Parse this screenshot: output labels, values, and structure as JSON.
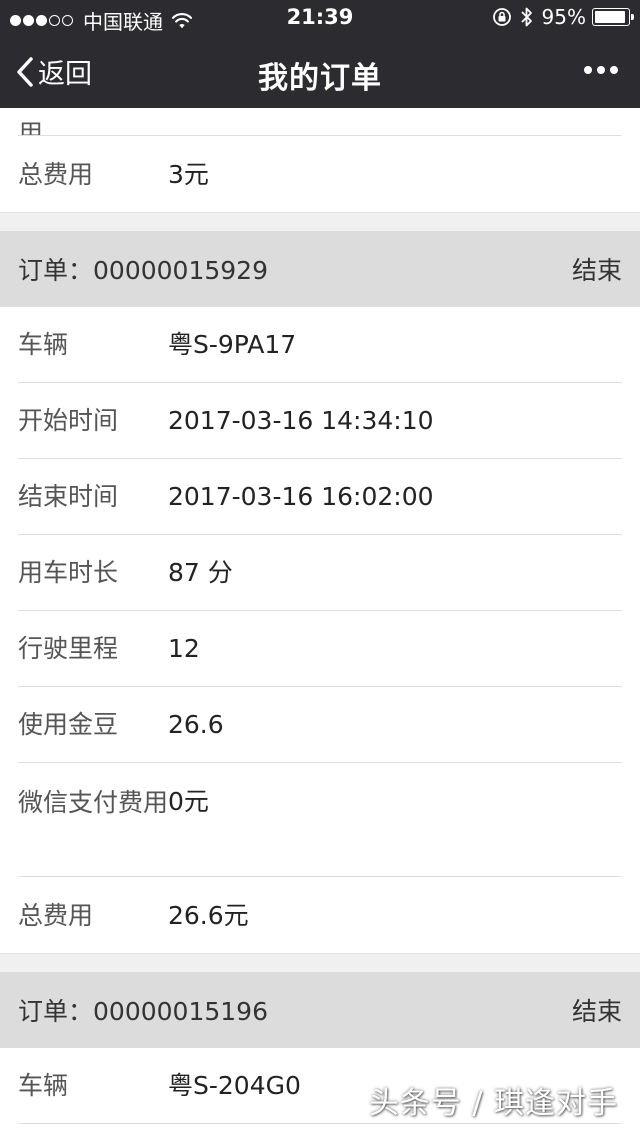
{
  "status_bar": {
    "carrier": "中国联通",
    "time": "21:39",
    "battery": "95%",
    "battery_level": 0.95
  },
  "nav": {
    "back_label": "返回",
    "title": "我的订单"
  },
  "previous_order_tail": {
    "partial_label": "用",
    "total_label": "总费用",
    "total_value": "3元"
  },
  "orders": [
    {
      "order_label": "订单：",
      "order_no": "00000015929",
      "status": "结束",
      "rows": [
        {
          "label": "车辆",
          "value": "粤S-9PA17"
        },
        {
          "label": "开始时间",
          "value": "2017-03-16 14:34:10"
        },
        {
          "label": "结束时间",
          "value": "2017-03-16 16:02:00"
        },
        {
          "label": "用车时长",
          "value": "87 分"
        },
        {
          "label": "行驶里程",
          "value": "12"
        },
        {
          "label": "使用金豆",
          "value": "26.6"
        },
        {
          "label": "微信支付费用",
          "value": "0元"
        },
        {
          "label": "总费用",
          "value": "26.6元"
        }
      ]
    },
    {
      "order_label": "订单：",
      "order_no": "00000015196",
      "status": "结束",
      "rows": [
        {
          "label": "车辆",
          "value": "粤S-204G0"
        }
      ]
    }
  ],
  "watermark": "头条号 / 琪逢对手",
  "colors": {
    "navbar": "#2c2c30",
    "order_header": "#dcdcdc",
    "separator": "#dedede",
    "gap": "#f0f0f0"
  }
}
